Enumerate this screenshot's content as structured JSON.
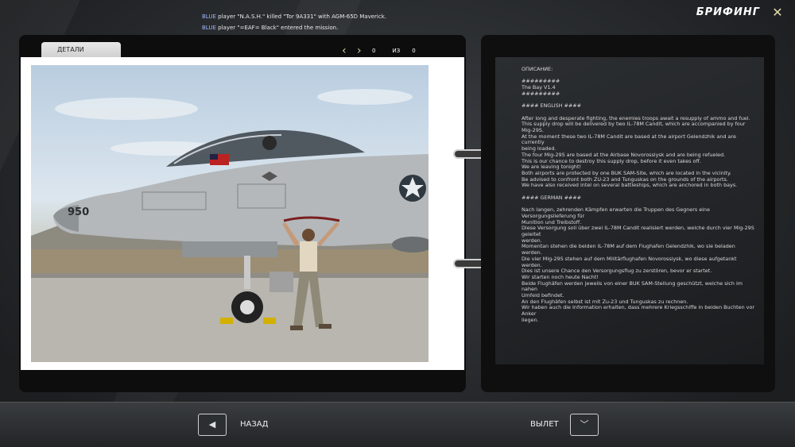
{
  "screen_title": "БРИФИНГ",
  "close_glyph": "✕",
  "chat_log": [
    {
      "team": "BLUE",
      "text": "player \"N.A.S.H.\" killed \"Tor 9A331\" with AGM-65D Maverick."
    },
    {
      "team": "BLUE",
      "text": "player \"=EAF= Black\" entered the mission."
    }
  ],
  "details_tab": "ДЕТАЛИ",
  "pager": {
    "current": "0",
    "of_label": "ИЗ",
    "total": "0"
  },
  "photo": {
    "tail_number": "950"
  },
  "description": "ОПИСАНИЕ:\n\n#########\nThe Bay V1.4\n#########\n\n#### ENGLISH ####\n\nAfter long and desperate fighting, the enemies troops await a resupply of ammo and fuel.\nThis supply drop will be delivered by two IL-78M Candit, which are accompanied by four Mig-29S.\nAt the moment these two IL-78M Candit are based at the airport Gelendzhik and are currently\nbeing loaded.\nThe four Mig-29S are based at the Airbase Novorossiysk and are being refueled.\nThis is our chance to destroy this supply drop, before it even takes off.\nWe are leaving tonight!\nBoth airports are protected by one BUK SAM-Site, which are located in the vicinity.\nBe advised to confront both ZU-23 and Tunguskas on the grounds of the airports.\nWe have also received intel on several battleships, which are anchored in both bays.\n\n#### GERMAN ####\n\nNach langen, zehrenden Kämpfen erwarten die Truppen des Gegners eine Versorgungslieferung für\nMunition und Treibstoff.\nDiese Versorgung soll über zwei IL-78M Candit realisiert werden, welche durch vier Mig-29S geleitet\nwerden.\nMomentan stehen die beiden IL-78M auf dem Flughafen Gelendzhik, wo sie beladen werden.\nDie vier Mig-29S stehen auf dem Militärflughafen Novorossiysk, wo diese aufgetankt werden.\nDies ist unsere Chance den Versorgungsflug zu zerstören, bevor er startet.\nWir starten noch heute Nacht!\nBeide Flughäfen werden jeweils von einer BUK SAM-Stellung geschützt, welche sich im nahen\nUmfeld befindet.\nAn den Flughäfen selbst ist mit Zu-23 und Tunguskas zu rechnen.\nWir haben auch die Information erhalten, dass mehrere Kriegsschiffe in beiden Buchten vor Anker\nliegen.",
  "bottom": {
    "back_label": "НАЗАД",
    "fly_label": "ВЫЛЕТ"
  },
  "colors": {
    "team_blue": "#9fb6ff",
    "accent_arrow": "#cfd59a"
  }
}
